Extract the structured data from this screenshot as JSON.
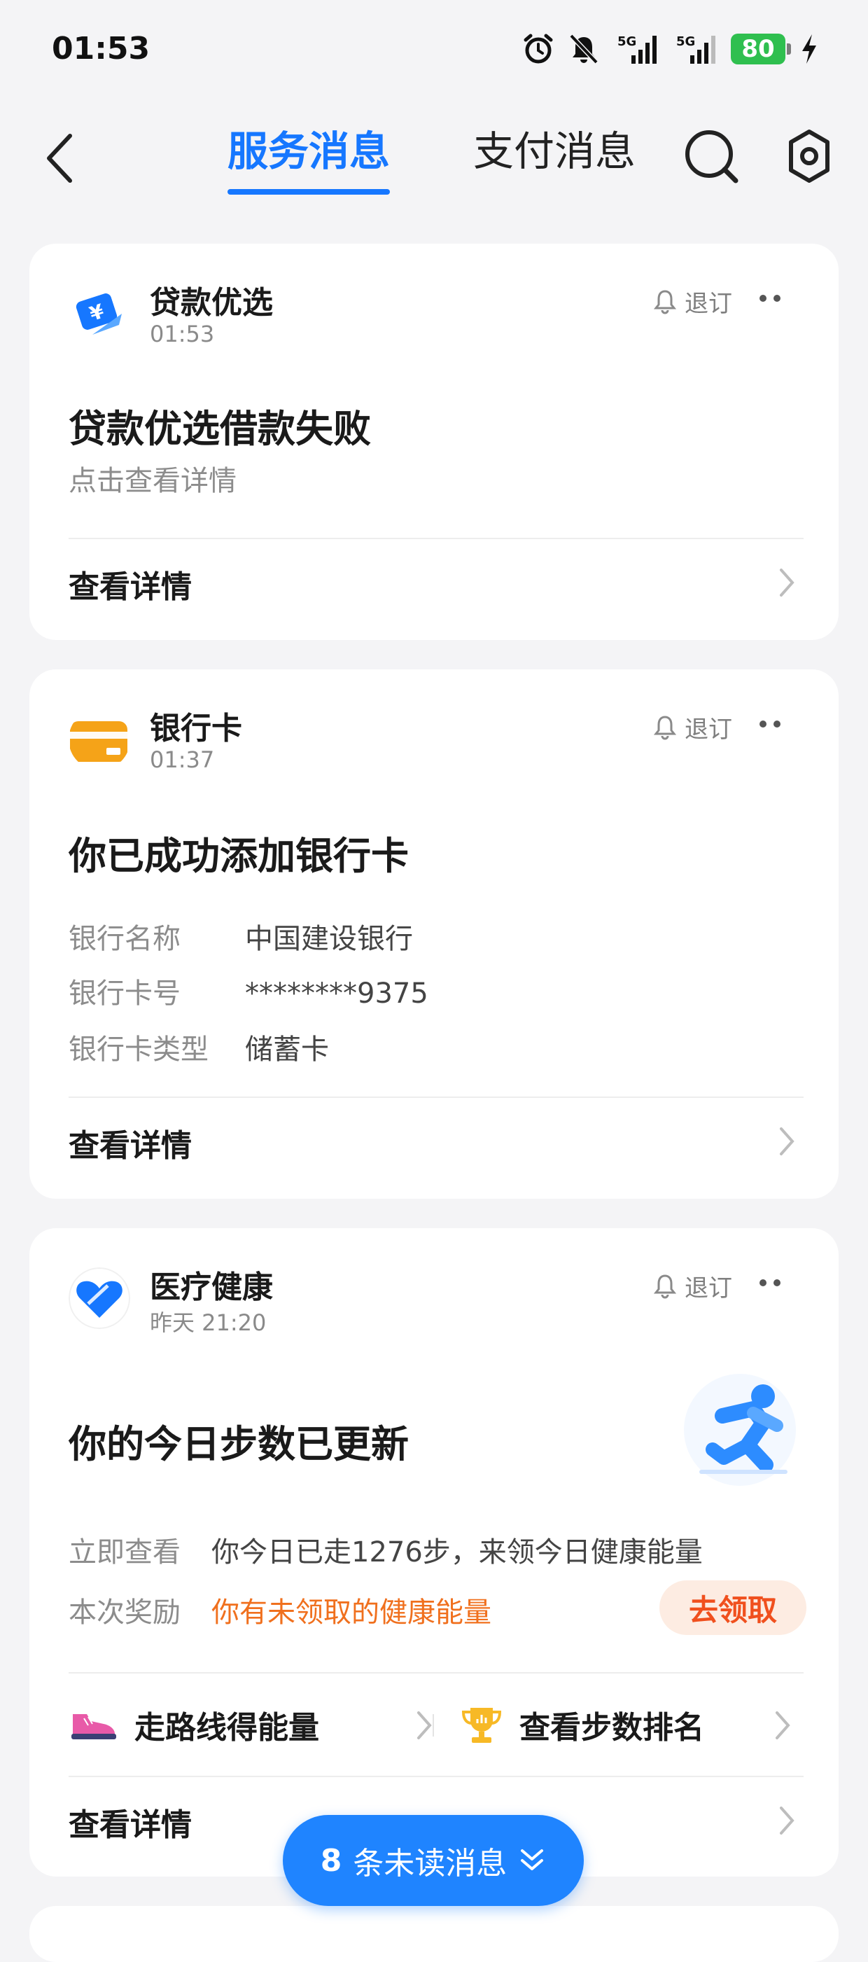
{
  "status_bar": {
    "time": "01:53",
    "battery": "80",
    "icons": [
      "alarm-icon",
      "mute-icon",
      "signal-5g-icon",
      "signal-5g-icon",
      "battery-icon",
      "charging-icon"
    ]
  },
  "nav": {
    "tabs": [
      {
        "label": "服务消息",
        "active": true
      },
      {
        "label": "支付消息",
        "active": false
      }
    ],
    "accent_color": "#1677ff"
  },
  "cards": [
    {
      "app_name": "贷款优选",
      "time": "01:53",
      "unsubscribe": "退订",
      "title": "贷款优选借款失败",
      "subtitle": "点击查看详情",
      "detail": "查看详情"
    },
    {
      "app_name": "银行卡",
      "time": "01:37",
      "unsubscribe": "退订",
      "title": "你已成功添加银行卡",
      "fields": [
        {
          "label": "银行名称",
          "value": "中国建设银行"
        },
        {
          "label": "银行卡号",
          "value": "********9375"
        },
        {
          "label": "银行卡类型",
          "value": "储蓄卡"
        }
      ],
      "detail": "查看详情"
    },
    {
      "app_name": "医疗健康",
      "time": "昨天 21:20",
      "unsubscribe": "退订",
      "title": "你的今日步数已更新",
      "fields": [
        {
          "label": "立即查看",
          "value": "你今日已走1276步，来领今日健康能量"
        },
        {
          "label": "本次奖励",
          "value": "你有未领取的健康能量"
        }
      ],
      "claim_button": "去领取",
      "actions": [
        {
          "label": "走路线得能量",
          "icon": "sneaker-icon"
        },
        {
          "label": "查看步数排名",
          "icon": "trophy-icon"
        }
      ],
      "detail": "查看详情"
    }
  ],
  "unread": {
    "count": "8",
    "label": "条未读消息"
  }
}
